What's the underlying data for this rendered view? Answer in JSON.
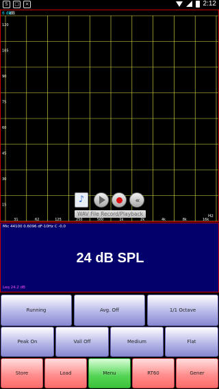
{
  "status_bar": {
    "time": "2:12",
    "left_icons": [
      "S",
      "□",
      "×"
    ]
  },
  "spectrum": {
    "reference_label": "6 dB",
    "y_axis_unit": "dB",
    "x_axis_unit": "Hz",
    "y_ticks": [
      "120",
      "105",
      "90",
      "75",
      "60",
      "45",
      "30",
      "15"
    ],
    "x_ticks": [
      "31",
      "62",
      "125",
      "250",
      "500",
      "1k",
      "2k",
      "4k",
      "8k",
      "16k"
    ]
  },
  "wav_player": {
    "label": "WAV File Record/Playback",
    "file_icon": "music-file-icon",
    "play_icon": "play-icon",
    "record_icon": "record-icon",
    "rewind_icon": "rewind-icon"
  },
  "spl": {
    "mic_info": "Mic 44100 0.6096 dF-10Hz C -0.0",
    "value": "24 dB SPL",
    "leq": "Leq 24.2 dB"
  },
  "buttons": {
    "row1": [
      "Running",
      "Avg. Off",
      "1/1 Octave"
    ],
    "row2": [
      "Peak On",
      "Vall Off",
      "Medium",
      "Flat"
    ],
    "row3": [
      "Store",
      "Load",
      "Menu",
      "RT60",
      "Gener"
    ]
  },
  "colors": {
    "grid": "#e6e64a",
    "spl_background": "#02006b",
    "panel_border": "#cc0000",
    "leq_text": "#ff49ff",
    "button_blue": "#8888d2",
    "button_red": "#ff6b6b",
    "button_green": "#3cc23c"
  }
}
